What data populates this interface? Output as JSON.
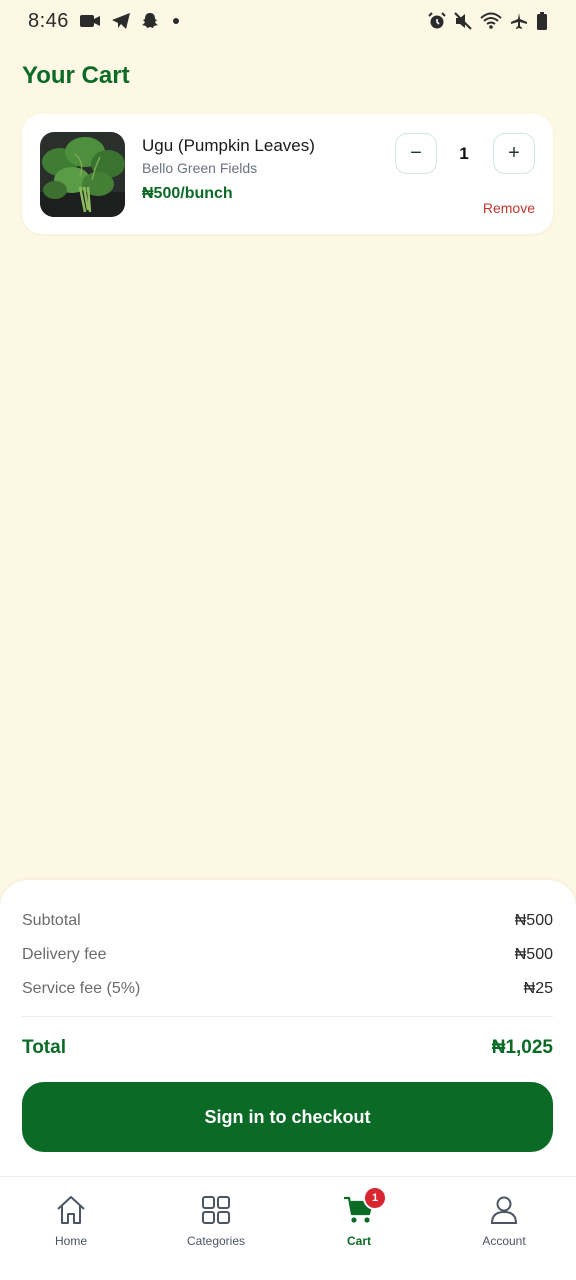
{
  "status_bar": {
    "time": "8:46"
  },
  "page": {
    "title": "Your Cart"
  },
  "cart": {
    "items": [
      {
        "name": "Ugu (Pumpkin Leaves)",
        "farm": "Bello Green Fields",
        "price": "₦500/bunch",
        "quantity": "1",
        "minus_label": "−",
        "plus_label": "+",
        "remove_label": "Remove"
      }
    ]
  },
  "summary": {
    "subtotal_label": "Subtotal",
    "subtotal_value": "₦500",
    "delivery_label": "Delivery fee",
    "delivery_value": "₦500",
    "service_label": "Service fee (5%)",
    "service_value": "₦25",
    "total_label": "Total",
    "total_value": "₦1,025",
    "checkout_label": "Sign in to checkout"
  },
  "nav": {
    "home": "Home",
    "categories": "Categories",
    "cart": "Cart",
    "cart_badge": "1",
    "account": "Account"
  },
  "colors": {
    "brand_green": "#0b6a26",
    "background": "#fdf8e4",
    "remove_red": "#c0392b",
    "badge_red": "#d7262f"
  }
}
